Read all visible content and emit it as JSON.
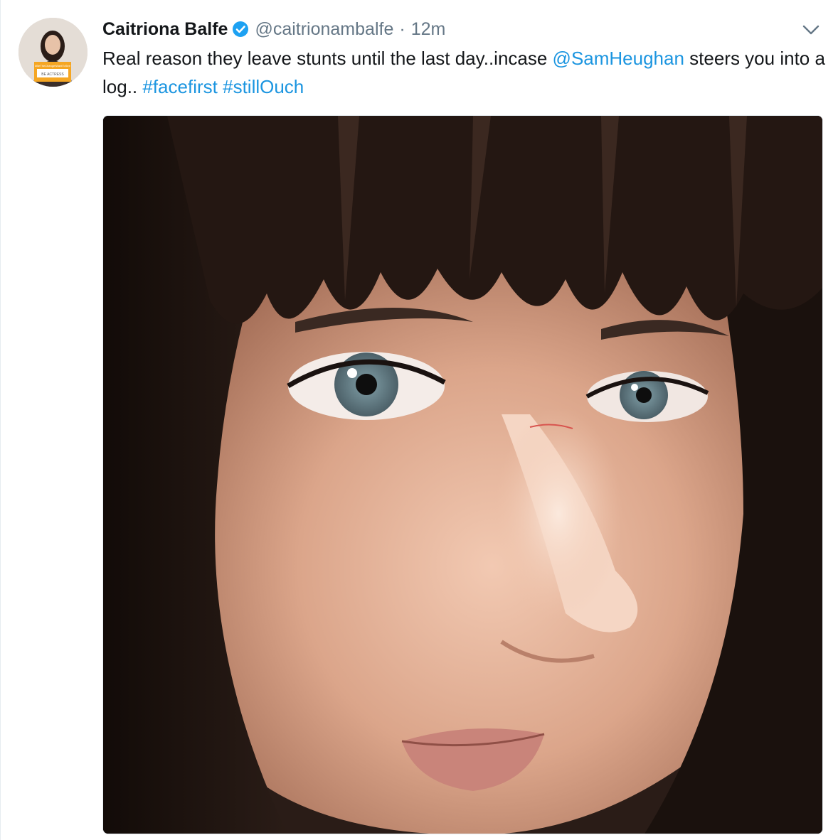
{
  "tweet": {
    "name": "Caitriona Balfe",
    "handle": "@caitrionambalfe",
    "separator": "·",
    "time": "12m",
    "text_part1": "Real reason they leave stunts until the last day..incase ",
    "mention": "@SamHeughan",
    "text_part2": " steers you into a log.. ",
    "hashtag1": "#facefirst",
    "hashtag_space": " ",
    "hashtag2": "#stillOuch"
  },
  "avatar": {
    "sign_line1": "#BeTheChangeIWantToSee",
    "sign_line2": "BE ACTRESS"
  },
  "icons": {
    "verified": "verified-badge-icon",
    "caret": "chevron-down-icon"
  },
  "colors": {
    "link": "#1b95e0",
    "verified": "#1da1f2",
    "secondary_text": "#657786"
  }
}
